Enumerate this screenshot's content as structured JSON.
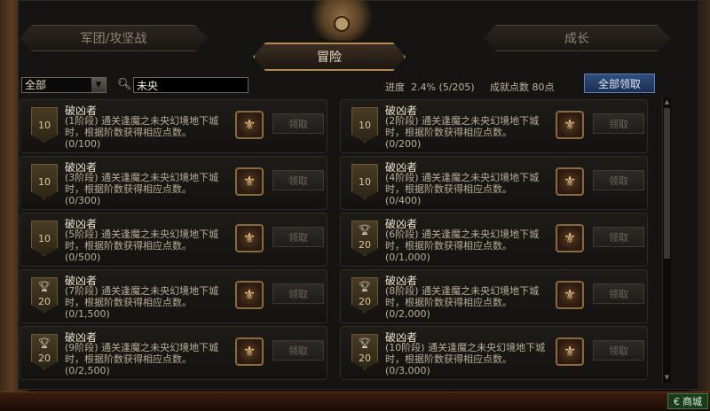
{
  "tabs": {
    "left": "军团/攻坚战",
    "active": "冒险",
    "right": "成长"
  },
  "filter": {
    "selected": "全部"
  },
  "search": {
    "value": "未央"
  },
  "progress": {
    "label": "进度",
    "value": "2.4% (5/205)"
  },
  "points": {
    "label": "成就点数",
    "value": "80点"
  },
  "claim_all_label": "全部领取",
  "cards": [
    {
      "title": "破凶者",
      "desc": "(1阶段) 通关逢魔之未央幻境地下城时，根据阶数获得相应点数。",
      "progress": "(0/100)",
      "points": "10",
      "trophy": false,
      "claim": "领取"
    },
    {
      "title": "破凶者",
      "desc": "(2阶段) 通关逢魔之未央幻境地下城时，根据阶数获得相应点数。",
      "progress": "(0/200)",
      "points": "10",
      "trophy": false,
      "claim": "领取"
    },
    {
      "title": "破凶者",
      "desc": "(3阶段) 通关逢魔之未央幻境地下城时，根据阶数获得相应点数。",
      "progress": "(0/300)",
      "points": "10",
      "trophy": false,
      "claim": "领取"
    },
    {
      "title": "破凶者",
      "desc": "(4阶段) 通关逢魔之未央幻境地下城时，根据阶数获得相应点数。",
      "progress": "(0/400)",
      "points": "10",
      "trophy": false,
      "claim": "领取"
    },
    {
      "title": "破凶者",
      "desc": "(5阶段) 通关逢魔之未央幻境地下城时，根据阶数获得相应点数。",
      "progress": "(0/500)",
      "points": "10",
      "trophy": false,
      "claim": "领取"
    },
    {
      "title": "破凶者",
      "desc": "(6阶段) 通关逢魔之未央幻境地下城时，根据阶数获得相应点数。",
      "progress": "(0/1,000)",
      "points": "20",
      "trophy": true,
      "claim": "领取"
    },
    {
      "title": "破凶者",
      "desc": "(7阶段) 通关逢魔之未央幻境地下城时，根据阶数获得相应点数。",
      "progress": "(0/1,500)",
      "points": "20",
      "trophy": true,
      "claim": "领取"
    },
    {
      "title": "破凶者",
      "desc": "(8阶段) 通关逢魔之未央幻境地下城时，根据阶数获得相应点数。",
      "progress": "(0/2,000)",
      "points": "20",
      "trophy": true,
      "claim": "领取"
    },
    {
      "title": "破凶者",
      "desc": "(9阶段) 通关逢魔之未央幻境地下城时，根据阶数获得相应点数。",
      "progress": "(0/2,500)",
      "points": "20",
      "trophy": true,
      "claim": "领取"
    },
    {
      "title": "破凶者",
      "desc": "(10阶段) 通关逢魔之未央幻境地下城时，根据阶数获得相应点数。",
      "progress": "(0/3,000)",
      "points": "20",
      "trophy": true,
      "claim": "领取"
    }
  ],
  "shop_label": "商城"
}
